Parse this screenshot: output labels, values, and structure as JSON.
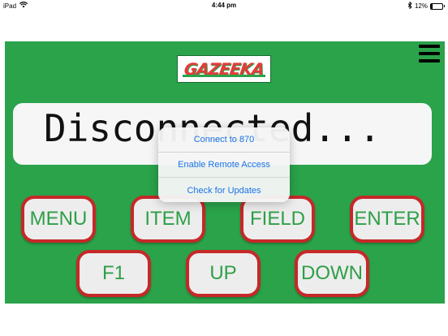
{
  "status_bar": {
    "device": "iPad",
    "time": "4:44 pm",
    "battery_percent": "12%",
    "battery_level": 0.12,
    "icons": [
      "wifi-icon",
      "bluetooth-icon",
      "battery-icon"
    ]
  },
  "app": {
    "logo_text": "GAZEEKA",
    "display_text": "Disconnected...",
    "colors": {
      "background": "#2aa34a",
      "button_border": "#c62828",
      "button_text": "#2e9f47",
      "logo_text": "#e53b3b",
      "popover_text": "#1a73e8"
    }
  },
  "keypad": {
    "menu": "MENU",
    "item": "ITEM",
    "field": "FIELD",
    "enter": "ENTER",
    "f1": "F1",
    "up": "UP",
    "down": "DOWN"
  },
  "popover": {
    "items": [
      "Connect to 870",
      "Enable Remote Access",
      "Check for Updates"
    ]
  }
}
